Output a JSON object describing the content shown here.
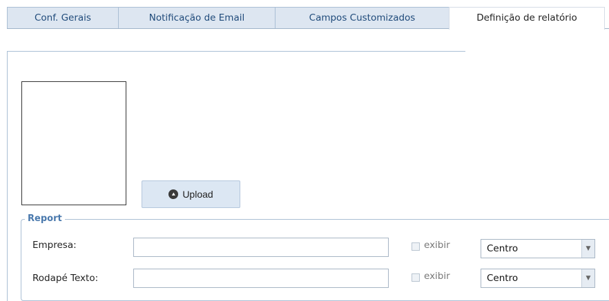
{
  "tabs": [
    {
      "label": "Conf. Gerais",
      "active": false
    },
    {
      "label": "Notificação de Email",
      "active": false
    },
    {
      "label": "Campos Customizados",
      "active": false
    },
    {
      "label": "Definição de relatório",
      "active": true
    }
  ],
  "logo": {
    "upload_label": "Upload",
    "upload_icon": "upload-icon"
  },
  "report": {
    "legend": "Report",
    "rows": [
      {
        "label": "Empresa:",
        "value": "",
        "show_label": "exibir",
        "show_checked": false,
        "align": "Centro"
      },
      {
        "label": "Rodapé Texto:",
        "value": "",
        "show_label": "exibir",
        "show_checked": false,
        "align": "Centro"
      }
    ]
  },
  "colors": {
    "tab_bg": "#dde6f1",
    "tab_text": "#1f4a7a",
    "border": "#a9bed4",
    "legend": "#4a79ad",
    "button_bg": "#dce7f3"
  }
}
